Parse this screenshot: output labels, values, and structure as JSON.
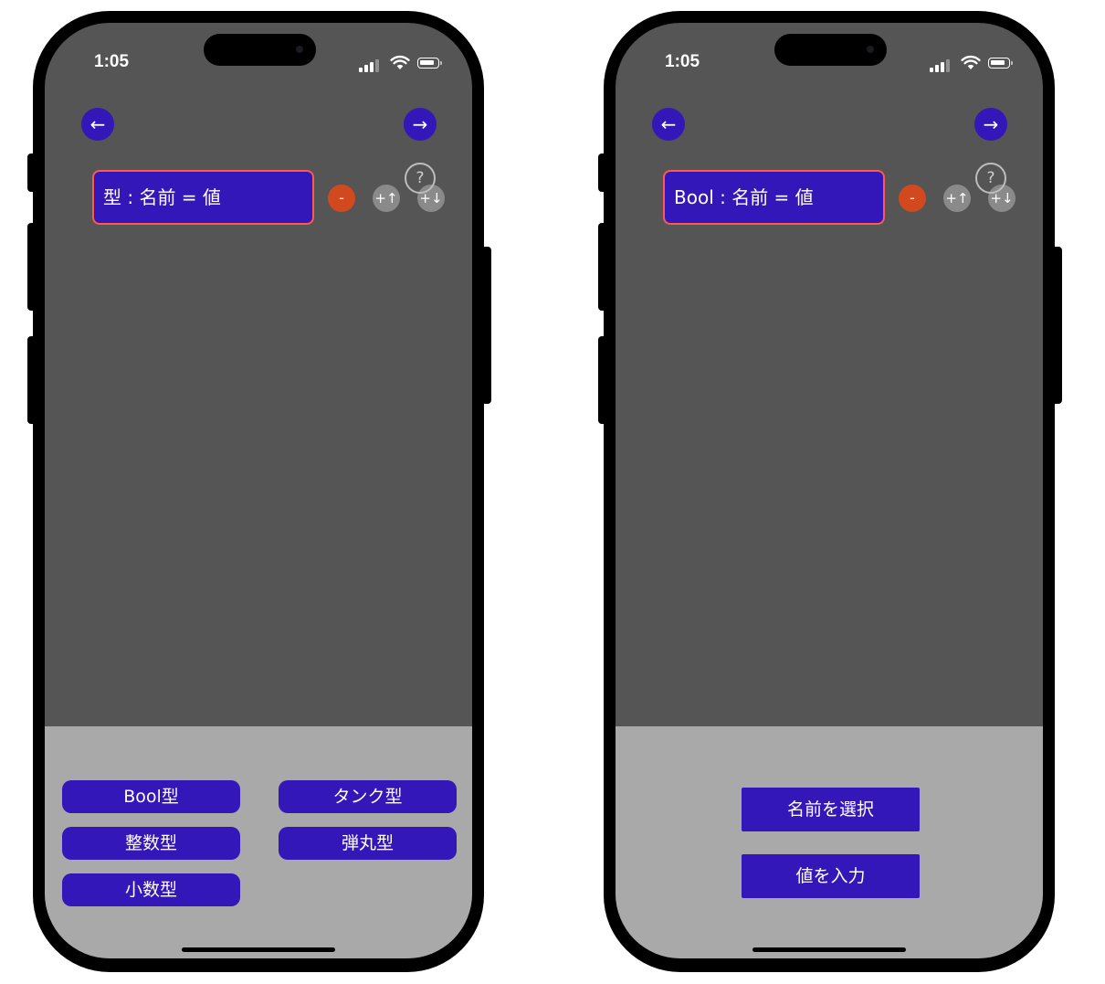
{
  "colors": {
    "screen_bg": "#555555",
    "panel_bg": "#a9a9a9",
    "accent": "#3317b8",
    "code_border": "#ff5a4d",
    "minus": "#d2491f",
    "gray_button": "#8a8a8a"
  },
  "left_phone": {
    "status": {
      "time": "1:05"
    },
    "nav": {
      "back_icon": "←",
      "forward_icon": "→"
    },
    "code_line": "型 : 名前 = 値",
    "controls": {
      "help": "?",
      "minus": "-",
      "insert_above": "+↑",
      "insert_below": "+↓"
    },
    "type_buttons": [
      {
        "label": "Bool型"
      },
      {
        "label": "タンク型"
      },
      {
        "label": "整数型"
      },
      {
        "label": "弾丸型"
      },
      {
        "label": "小数型"
      }
    ]
  },
  "right_phone": {
    "status": {
      "time": "1:05"
    },
    "nav": {
      "back_icon": "←",
      "forward_icon": "→"
    },
    "code_line": "Bool : 名前 = 値",
    "controls": {
      "help": "?",
      "minus": "-",
      "insert_above": "+↑",
      "insert_below": "+↓"
    },
    "action_buttons": [
      {
        "label": "名前を選択"
      },
      {
        "label": "値を入力"
      }
    ]
  }
}
